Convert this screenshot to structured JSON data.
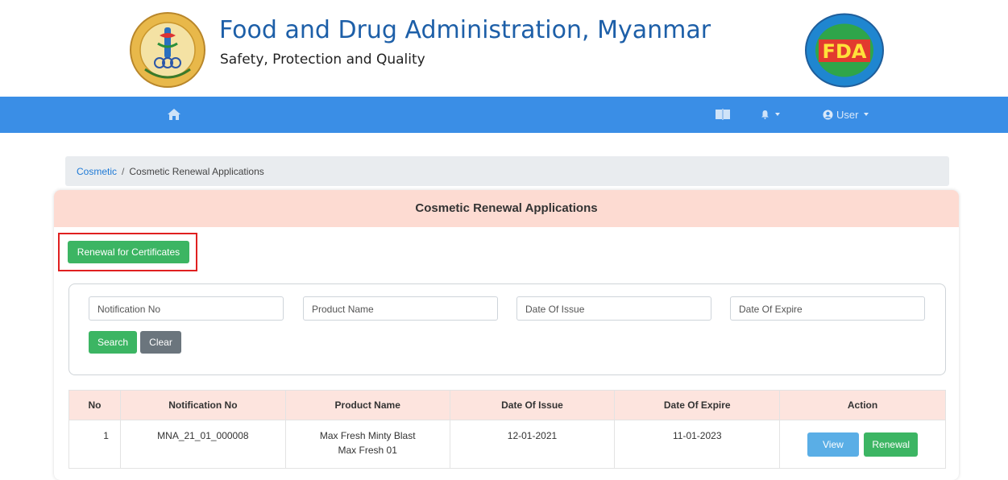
{
  "header": {
    "title": "Food and Drug Administration, Myanmar",
    "subtitle": "Safety, Protection and Quality",
    "left_logo_icon": "ministry-of-health-emblem",
    "right_logo_icon": "fda-logo",
    "right_logo_text": "FDA"
  },
  "nav": {
    "home_icon": "home-icon",
    "book_icon": "book-icon",
    "bell_icon": "bell-icon",
    "user_icon": "user-circle-icon",
    "user_label": "User"
  },
  "breadcrumb": {
    "link": "Cosmetic",
    "separator": "/",
    "current": "Cosmetic Renewal Applications"
  },
  "card": {
    "title": "Cosmetic Renewal Applications",
    "renew_button": "Renewal for Certificates"
  },
  "search": {
    "notification_placeholder": "Notification No",
    "product_placeholder": "Product Name",
    "issue_placeholder": "Date Of Issue",
    "expire_placeholder": "Date Of Expire",
    "search_button": "Search",
    "clear_button": "Clear"
  },
  "table": {
    "headers": [
      "No",
      "Notification No",
      "Product Name",
      "Date Of Issue",
      "Date Of Expire",
      "Action"
    ],
    "rows": [
      {
        "no": "1",
        "notification_no": "MNA_21_01_000008",
        "product_line1": "Max Fresh Minty Blast",
        "product_line2": "Max Fresh 01",
        "date_issue": "12-01-2021",
        "date_expire": "11-01-2023",
        "view_label": "View",
        "renewal_label": "Renewal"
      }
    ]
  },
  "colors": {
    "navbar": "#3a8ee6",
    "title_blue": "#1d5fa8",
    "green": "#3cb563",
    "card_header": "#fddbd2",
    "highlight": "#e02020"
  }
}
